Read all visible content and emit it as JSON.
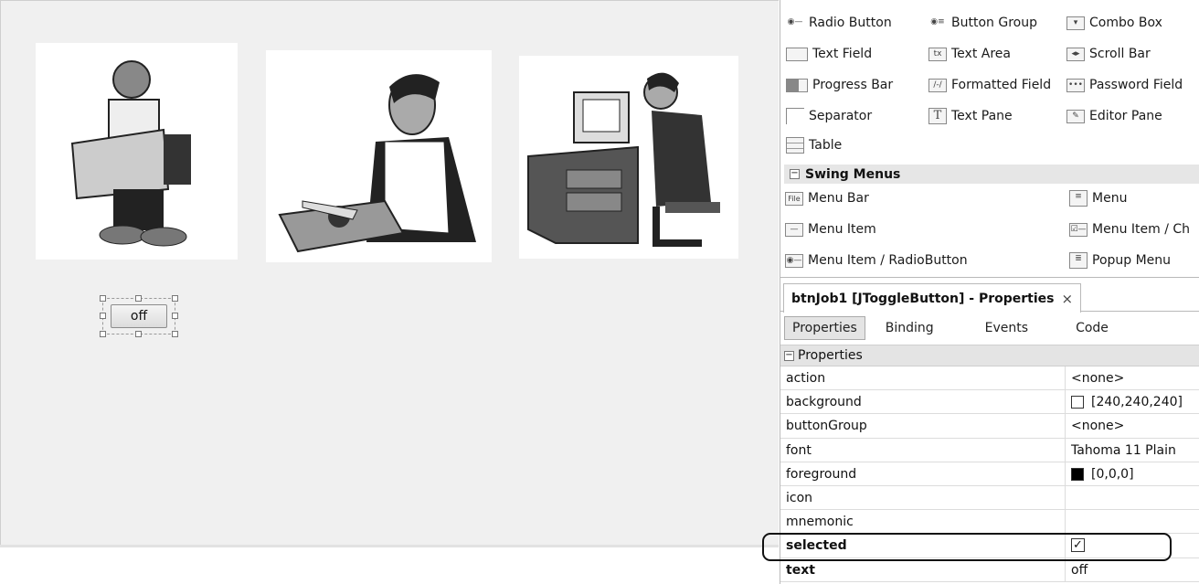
{
  "palette": {
    "row1": [
      "Radio Button",
      "Button Group",
      "Combo Box"
    ],
    "row2": [
      "Text Field",
      "Text Area",
      "Scroll Bar"
    ],
    "row3": [
      "Progress Bar",
      "Formatted Field",
      "Password Field"
    ],
    "row4": [
      "Separator",
      "Text Pane",
      "Editor Pane"
    ],
    "row5": [
      "Table"
    ],
    "menus_header": "Swing Menus",
    "menu_rows": [
      [
        "Menu Bar",
        "Menu"
      ],
      [
        "Menu Item",
        "Menu Item / Ch"
      ],
      [
        "Menu Item / RadioButton",
        "Popup Menu"
      ]
    ],
    "icons": {
      "text_area": "tx",
      "menu_bar": "File",
      "text_pane": "T"
    }
  },
  "toggle_button": {
    "label": "off"
  },
  "properties_panel": {
    "tab_title": "btnJob1 [JToggleButton] - Properties",
    "close_glyph": "×",
    "subtabs": [
      "Properties",
      "Binding",
      "Events",
      "Code"
    ],
    "group_label": "Properties",
    "group_toggle": "−",
    "rows": [
      {
        "name": "action",
        "value": "<none>"
      },
      {
        "name": "background",
        "value": "[240,240,240]",
        "swatch": "#f0f0f0"
      },
      {
        "name": "buttonGroup",
        "value": "<none>"
      },
      {
        "name": "font",
        "value": "Tahoma 11 Plain"
      },
      {
        "name": "foreground",
        "value": "[0,0,0]",
        "swatch": "#000000"
      },
      {
        "name": "icon",
        "value": ""
      },
      {
        "name": "mnemonic",
        "value": ""
      },
      {
        "name": "selected",
        "value": "✓",
        "checked": true
      },
      {
        "name": "text",
        "value": "off"
      }
    ]
  },
  "colors": {
    "canvas_bg": "#f0f0f0",
    "highlight_border": "#111111"
  }
}
